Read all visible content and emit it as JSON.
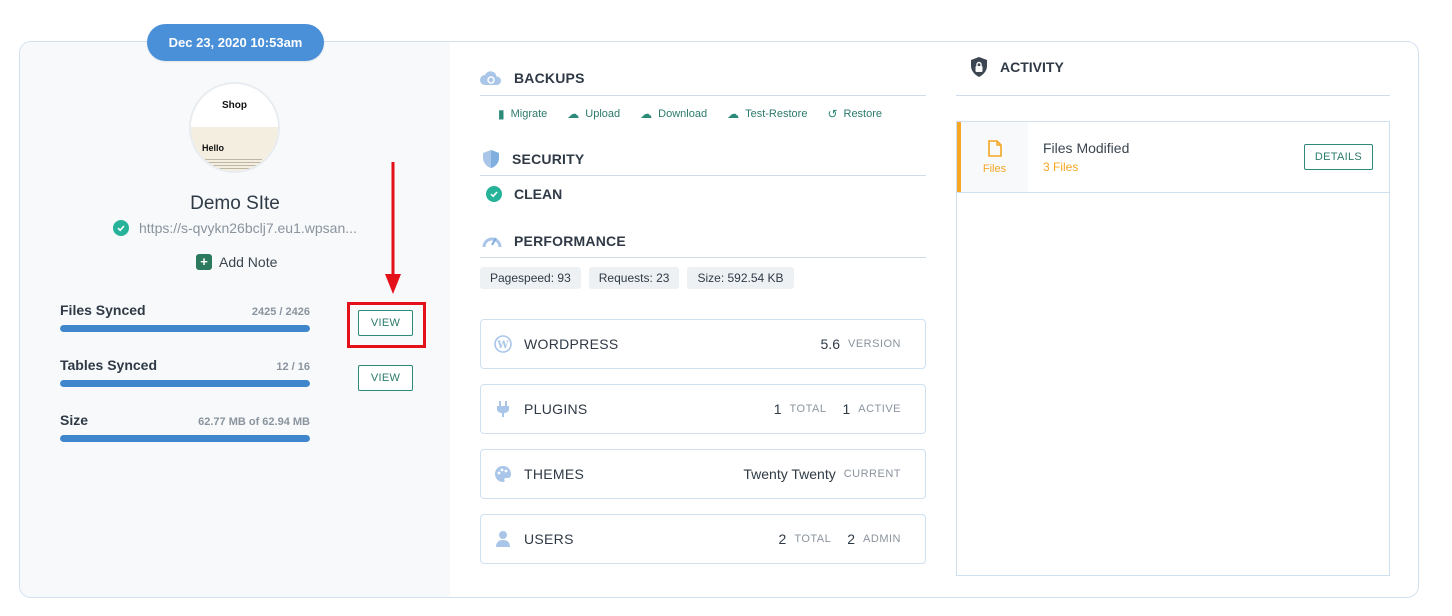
{
  "date": "Dec 23, 2020 10:53am",
  "site": {
    "thumb_title": "Shop",
    "thumb_heading": "Hello",
    "name": "Demo SIte",
    "url": "https://s-qvykn26bclj7.eu1.wpsan...",
    "add_note": "Add Note"
  },
  "stats": [
    {
      "label": "Files Synced",
      "value": "2425 / 2426",
      "progress": 0.9996
    },
    {
      "label": "Tables Synced",
      "value": "12 / 16",
      "progress": 1.0
    },
    {
      "label": "Size",
      "value": "62.77 MB of 62.94 MB",
      "progress": 1.0
    }
  ],
  "view_label": "VIEW",
  "backups": {
    "title": "BACKUPS",
    "actions": [
      "Migrate",
      "Upload",
      "Download",
      "Test-Restore",
      "Restore"
    ]
  },
  "security": {
    "title": "SECURITY",
    "status": "CLEAN"
  },
  "performance": {
    "title": "PERFORMANCE",
    "chips": [
      "Pagespeed: 93",
      "Requests: 23",
      "Size: 592.54 KB"
    ]
  },
  "cards": {
    "wordpress": {
      "name": "WORDPRESS",
      "num": "5.6",
      "unit": "VERSION"
    },
    "plugins": {
      "name": "PLUGINS",
      "num1": "1",
      "unit1": "TOTAL",
      "num2": "1",
      "unit2": "ACTIVE"
    },
    "themes": {
      "name": "THEMES",
      "num": "Twenty Twenty",
      "unit": "CURRENT"
    },
    "users": {
      "name": "USERS",
      "num1": "2",
      "unit1": "TOTAL",
      "num2": "2",
      "unit2": "ADMIN"
    }
  },
  "activity": {
    "title": "ACTIVITY",
    "item": {
      "type": "Files",
      "title": "Files Modified",
      "sub": "3 Files",
      "button": "DETAILS"
    }
  },
  "colors": {
    "accent": "#4a90d9",
    "green": "#2b8a78",
    "orange": "#f5a623",
    "annotation_red": "#e4101a"
  }
}
